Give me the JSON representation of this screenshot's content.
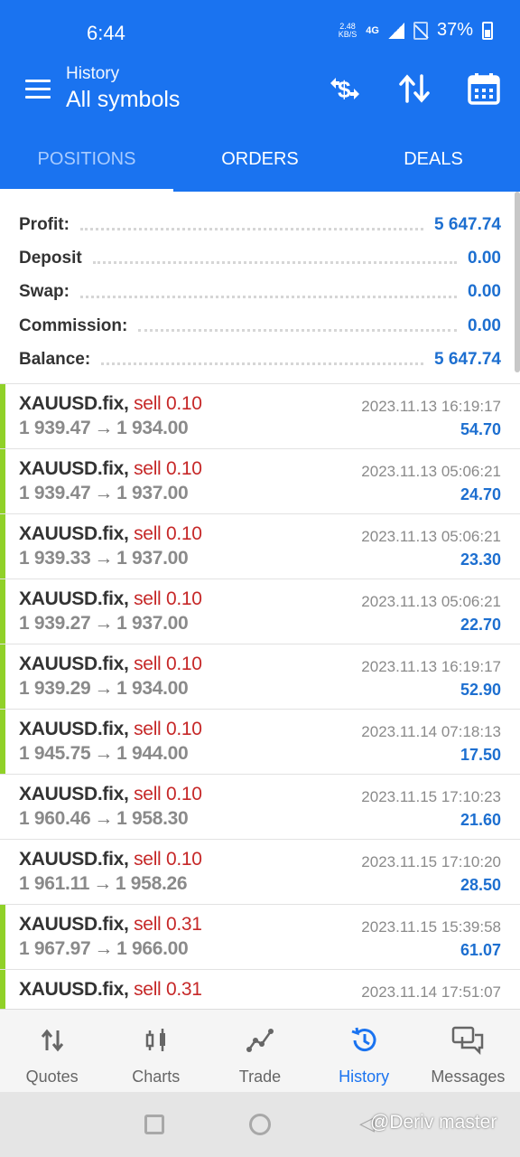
{
  "status_bar": {
    "time": "6:44",
    "net_speed": "2.48",
    "net_unit": "KB/S",
    "network": "4G",
    "battery": "37%"
  },
  "toolbar": {
    "subtitle": "History",
    "title": "All symbols",
    "icons": [
      "menu-icon",
      "currency-exchange-icon",
      "sort-icon",
      "calendar-icon"
    ]
  },
  "tabs": [
    {
      "label": "POSITIONS",
      "active": true
    },
    {
      "label": "ORDERS",
      "active": false
    },
    {
      "label": "DEALS",
      "active": false
    }
  ],
  "summary": [
    {
      "label": "Profit:",
      "value": "5 647.74"
    },
    {
      "label": "Deposit",
      "value": "0.00"
    },
    {
      "label": "Swap:",
      "value": "0.00"
    },
    {
      "label": "Commission:",
      "value": "0.00"
    },
    {
      "label": "Balance:",
      "value": "5 647.74"
    }
  ],
  "deals": [
    {
      "symbol": "XAUUSD.fix,",
      "side": "sell 0.10",
      "open": "1 939.47",
      "close": "1 934.00",
      "time": "2023.11.13 16:19:17",
      "profit": "54.70",
      "marked": true
    },
    {
      "symbol": "XAUUSD.fix,",
      "side": "sell 0.10",
      "open": "1 939.47",
      "close": "1 937.00",
      "time": "2023.11.13 05:06:21",
      "profit": "24.70",
      "marked": true
    },
    {
      "symbol": "XAUUSD.fix,",
      "side": "sell 0.10",
      "open": "1 939.33",
      "close": "1 937.00",
      "time": "2023.11.13 05:06:21",
      "profit": "23.30",
      "marked": true
    },
    {
      "symbol": "XAUUSD.fix,",
      "side": "sell 0.10",
      "open": "1 939.27",
      "close": "1 937.00",
      "time": "2023.11.13 05:06:21",
      "profit": "22.70",
      "marked": true
    },
    {
      "symbol": "XAUUSD.fix,",
      "side": "sell 0.10",
      "open": "1 939.29",
      "close": "1 934.00",
      "time": "2023.11.13 16:19:17",
      "profit": "52.90",
      "marked": true
    },
    {
      "symbol": "XAUUSD.fix,",
      "side": "sell 0.10",
      "open": "1 945.75",
      "close": "1 944.00",
      "time": "2023.11.14 07:18:13",
      "profit": "17.50",
      "marked": true
    },
    {
      "symbol": "XAUUSD.fix,",
      "side": "sell 0.10",
      "open": "1 960.46",
      "close": "1 958.30",
      "time": "2023.11.15 17:10:23",
      "profit": "21.60",
      "marked": false
    },
    {
      "symbol": "XAUUSD.fix,",
      "side": "sell 0.10",
      "open": "1 961.11",
      "close": "1 958.26",
      "time": "2023.11.15 17:10:20",
      "profit": "28.50",
      "marked": false
    },
    {
      "symbol": "XAUUSD.fix,",
      "side": "sell 0.31",
      "open": "1 967.97",
      "close": "1 966.00",
      "time": "2023.11.15 15:39:58",
      "profit": "61.07",
      "marked": true
    },
    {
      "symbol": "XAUUSD.fix,",
      "side": "sell 0.31",
      "open": "",
      "close": "",
      "time": "2023.11.14 17:51:07",
      "profit": "",
      "marked": true
    }
  ],
  "arrow_glyph": "→",
  "bottom_nav": [
    {
      "label": "Quotes",
      "icon": "quotes-icon",
      "active": false
    },
    {
      "label": "Charts",
      "icon": "charts-icon",
      "active": false
    },
    {
      "label": "Trade",
      "icon": "trade-icon",
      "active": false
    },
    {
      "label": "History",
      "icon": "history-icon",
      "active": true
    },
    {
      "label": "Messages",
      "icon": "messages-icon",
      "active": false
    }
  ],
  "watermark": "@Deriv master",
  "colors": {
    "header_blue": "#1a73f0",
    "value_blue": "#1d6fd0",
    "sell_red": "#c62828",
    "profit_marker_green": "#90d128"
  }
}
